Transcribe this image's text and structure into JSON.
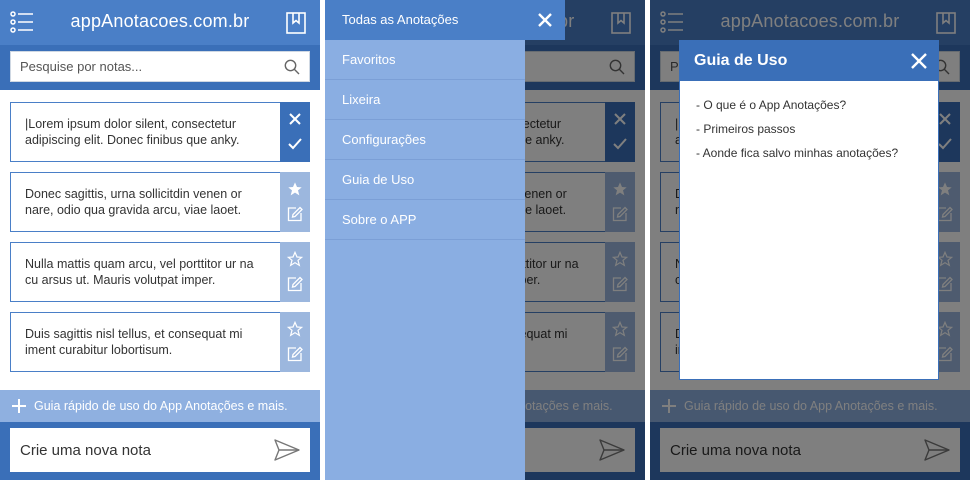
{
  "header": {
    "title": "appAnotacoes.com.br"
  },
  "search": {
    "placeholder": "Pesquise por notas..."
  },
  "notes": [
    {
      "text": "|Lorem ipsum dolor silent, consectetur adipiscing elit. Donec finibus que anky.",
      "state": "editing"
    },
    {
      "text": "Donec sagittis, urna sollicitdin venen or nare, odio qua gravida arcu, viae laoet.",
      "state": "favorite"
    },
    {
      "text": "Nulla mattis quam arcu, vel porttitor ur na cu arsus ut. Mauris volutpat imper.",
      "state": "normal"
    },
    {
      "text": "Duis sagittis nisl tellus, et consequat mi iment curabitur lobortisum.",
      "state": "normal"
    }
  ],
  "guide_bar": {
    "text": "Guia rápido de uso do App Anotações e mais."
  },
  "compose": {
    "placeholder": "Crie uma nova nota"
  },
  "drawer": {
    "items": [
      {
        "label": "Todas as Anotações"
      },
      {
        "label": "Favoritos"
      },
      {
        "label": "Lixeira"
      },
      {
        "label": "Configurações"
      },
      {
        "label": "Guia de Uso"
      },
      {
        "label": "Sobre o APP"
      }
    ]
  },
  "modal": {
    "title": "Guia de Uso",
    "links": [
      {
        "label": "- O que é o App Anotações?"
      },
      {
        "label": "- Primeiros passos"
      },
      {
        "label": "- Aonde fica salvo minhas anotações?"
      }
    ]
  },
  "colors": {
    "primary": "#3a6fb8",
    "header": "#4a7fc7",
    "light_accent": "#8fb0e0",
    "drawer_bg": "#8aaee2"
  },
  "icons": {
    "menu": "list-menu-icon",
    "bookmark": "bookmark-icon",
    "search": "search-icon",
    "close": "close-icon",
    "confirm": "check-icon",
    "favorite_filled": "star-filled-icon",
    "favorite_empty": "star-outline-icon",
    "edit": "edit-icon",
    "add": "plus-icon",
    "send": "send-icon"
  }
}
